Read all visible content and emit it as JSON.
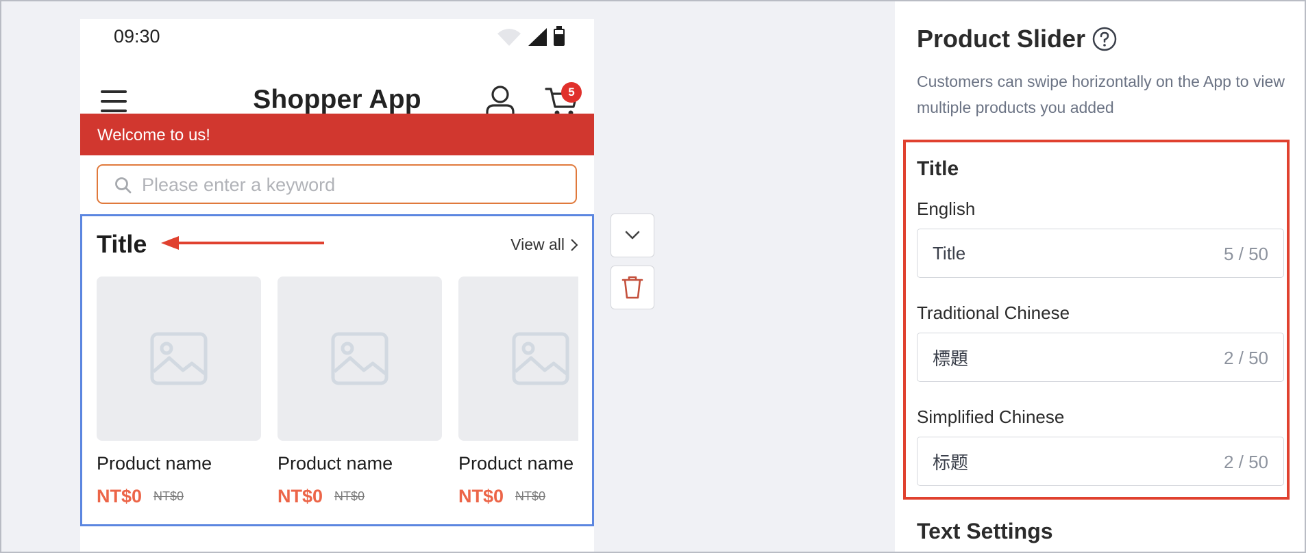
{
  "status_bar": {
    "time": "09:30"
  },
  "app": {
    "title": "Shopper App",
    "cart_count": "5",
    "welcome": "Welcome to us!",
    "search_placeholder": "Please enter a keyword"
  },
  "slider": {
    "title": "Title",
    "view_all": "View all",
    "products": [
      {
        "name": "Product name",
        "price": "NT$0",
        "original_price": "NT$0"
      },
      {
        "name": "Product name",
        "price": "NT$0",
        "original_price": "NT$0"
      },
      {
        "name": "Product name",
        "price": "NT$0",
        "original_price": "NT$0"
      }
    ]
  },
  "panel": {
    "title": "Product Slider",
    "description": "Customers can swipe horizontally on the App to view multiple products you added",
    "section_title": "Title",
    "fields": [
      {
        "label": "English",
        "value": "Title",
        "count": "5 / 50"
      },
      {
        "label": "Traditional Chinese",
        "value": "標題",
        "count": "2 / 50"
      },
      {
        "label": "Simplified Chinese",
        "value": "标题",
        "count": "2 / 50"
      }
    ],
    "next_section": "Text Settings"
  },
  "colors": {
    "brand_red": "#d1372f",
    "price_red": "#ec6548",
    "highlight_red": "#e0412f",
    "selection_blue": "#5b86e0",
    "search_border": "#e0793b"
  }
}
